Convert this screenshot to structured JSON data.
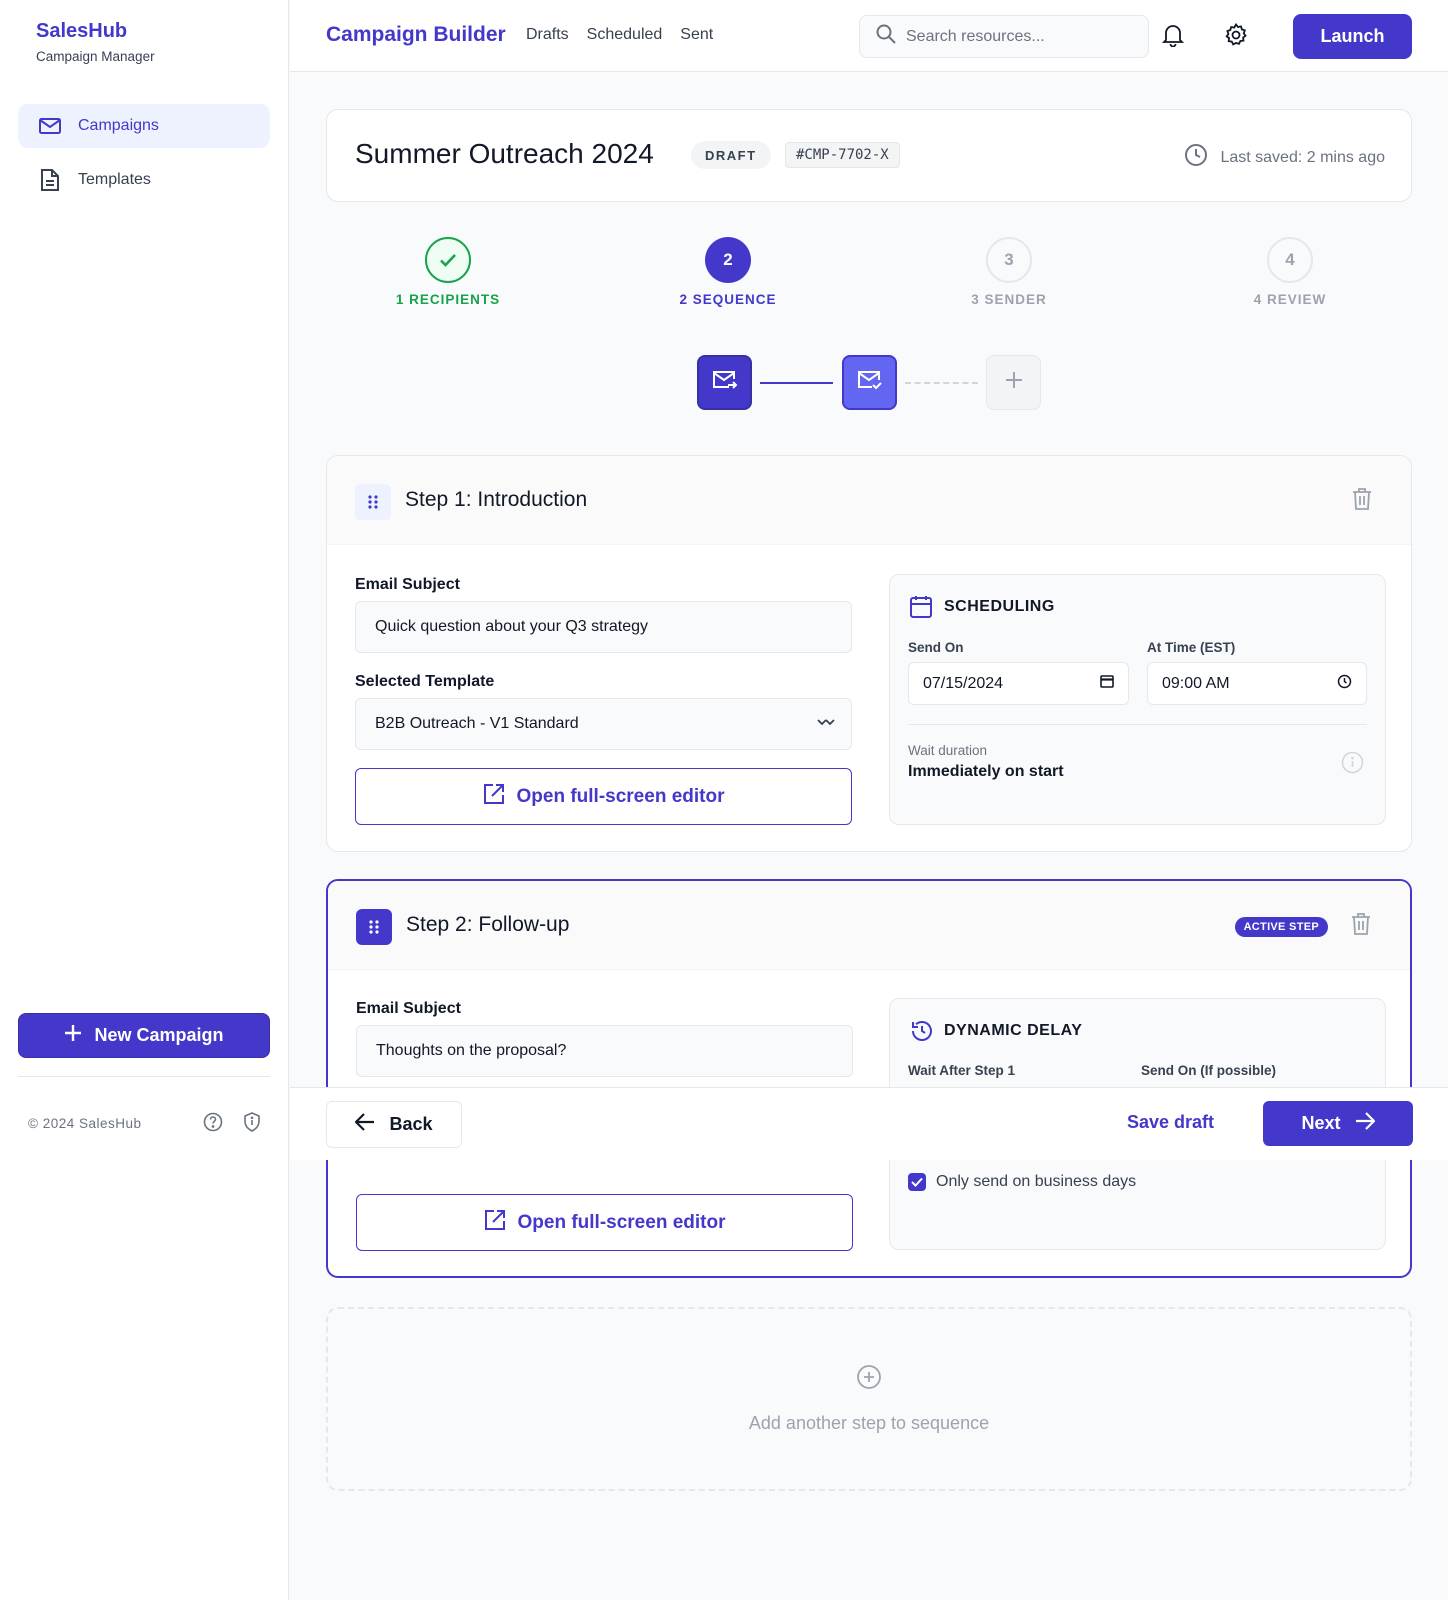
{
  "sidebar": {
    "brand_title": "SalesHub",
    "brand_subtitle": "Campaign Manager",
    "items": [
      {
        "label": "Campaigns",
        "icon": "mail-icon",
        "active": true
      },
      {
        "label": "Templates",
        "icon": "document-icon",
        "active": false
      }
    ],
    "new_campaign_label": "New Campaign",
    "footer_text": "© 2024 SalesHub"
  },
  "header": {
    "title": "Campaign Builder",
    "tabs": [
      "Drafts",
      "Scheduled",
      "Sent"
    ],
    "search_placeholder": "Search resources...",
    "launch_label": "Launch"
  },
  "campaign": {
    "name": "Summer Outreach 2024",
    "status": "DRAFT",
    "id": "#CMP-7702-X",
    "last_saved": "Last saved: 2 mins ago"
  },
  "stepper": [
    {
      "number": "1",
      "label": "1 RECIPIENTS",
      "state": "done"
    },
    {
      "number": "2",
      "label": "2 SEQUENCE",
      "state": "current"
    },
    {
      "number": "3",
      "label": "3 SENDER",
      "state": "todo"
    },
    {
      "number": "4",
      "label": "4 REVIEW",
      "state": "todo"
    }
  ],
  "steps": [
    {
      "title": "Step 1: Introduction",
      "subject_label": "Email Subject",
      "subject": "Quick question about your Q3 strategy",
      "template_label": "Selected Template",
      "template": "B2B Outreach - V1 Standard",
      "editor_label": "Open full-screen editor",
      "panel_title": "SCHEDULING",
      "send_on_label": "Send On",
      "send_on": "07/15/2024",
      "time_label": "At Time (EST)",
      "time": "09:00 AM",
      "wait_label": "Wait duration",
      "wait_value": "Immediately on start"
    },
    {
      "title": "Step 2: Follow-up",
      "badge": "ACTIVE STEP",
      "subject_label": "Email Subject",
      "subject": "Thoughts on the proposal?",
      "editor_label": "Open full-screen editor",
      "panel_title": "DYNAMIC DELAY",
      "wait_after_label": "Wait After Step 1",
      "send_on_label": "Send On (If possible)",
      "business_days_label": "Only send on business days",
      "business_days_checked": true
    }
  ],
  "actions": {
    "back_label": "Back",
    "save_draft_label": "Save draft",
    "next_label": "Next"
  },
  "add_step_label": "Add another step to sequence",
  "colors": {
    "primary": "#4338ca",
    "success": "#16a34a",
    "muted": "#9ca3af"
  }
}
